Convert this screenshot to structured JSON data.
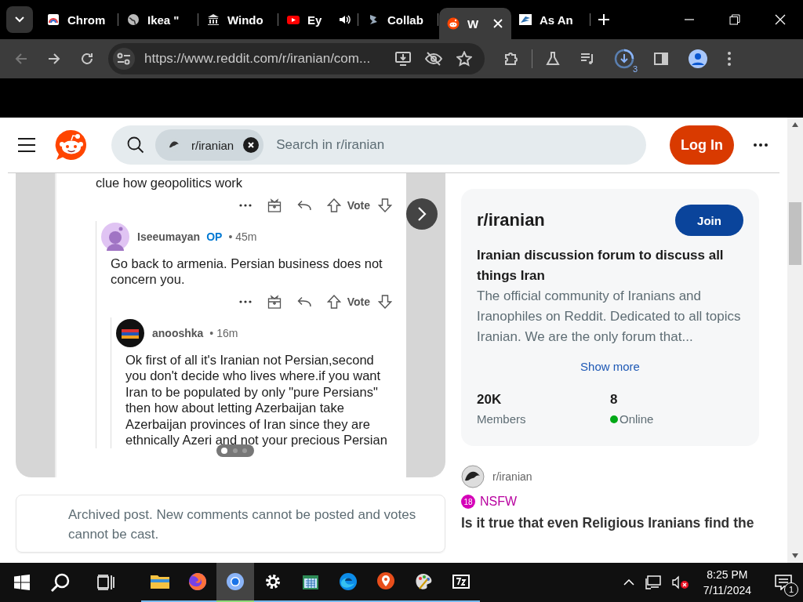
{
  "browser": {
    "tabs": [
      {
        "title": "Chrom",
        "selected": false,
        "audio": false
      },
      {
        "title": "Ikea \"",
        "selected": false,
        "audio": false
      },
      {
        "title": "Windo",
        "selected": false,
        "audio": false
      },
      {
        "title": "Ey",
        "selected": false,
        "audio": true
      },
      {
        "title": "Collab",
        "selected": false,
        "audio": false
      },
      {
        "title": "W",
        "selected": true,
        "audio": false
      },
      {
        "title": "As An",
        "selected": false,
        "audio": false
      }
    ],
    "url": "https://www.reddit.com/r/iranian/com...",
    "download_badge": "3"
  },
  "reddit": {
    "header": {
      "search_chip": "r/iranian",
      "placeholder": "Search in r/iranian",
      "login": "Log In"
    },
    "media": {
      "comments": [
        {
          "kind": "fragment",
          "text": "clue how geopolitics work",
          "vote": "Vote"
        },
        {
          "kind": "comment",
          "author": "Iseeumayan",
          "op": "OP",
          "time": "• 45m",
          "text": "Go back to armenia. Persian business does not concern you.",
          "vote": "Vote"
        },
        {
          "kind": "comment",
          "author": "anooshka",
          "time": "• 16m",
          "text": "Ok first of all it's Iranian not Persian,second you don't decide who lives where.if you want Iran to be populated by only \"pure Persians\" then how about letting Azerbaijan take Azerbaijan provinces of Iran since they are ethnically Azeri and not your precious Persian"
        }
      ]
    },
    "archived": "Archived post. New comments cannot be posted and votes cannot be cast.",
    "community": {
      "name": "r/iranian",
      "join": "Join",
      "tagline": "Iranian discussion forum to discuss all things Iran",
      "description": "The official community of Iranians and Iranophiles on Reddit. Dedicated to all topics Iranian. We are the only forum that...",
      "show_more": "Show more",
      "stats": [
        {
          "kind": "count",
          "value": "20K",
          "label": "Members"
        },
        {
          "kind": "online",
          "value": "8",
          "label": "Online"
        }
      ]
    },
    "related": {
      "community": "r/iranian",
      "nsfw_badge": "18",
      "nsfw": "NSFW",
      "title": "Is it true that even Religious Iranians find the"
    }
  },
  "taskbar": {
    "apps": [
      {
        "selected": false,
        "running": true
      },
      {
        "selected": false,
        "running": true
      },
      {
        "selected": true,
        "running": true
      },
      {
        "selected": false,
        "running": true
      },
      {
        "selected": false,
        "running": true
      },
      {
        "selected": false,
        "running": true
      },
      {
        "selected": false,
        "running": true
      },
      {
        "selected": false,
        "running": true
      },
      {
        "selected": false,
        "running": true
      }
    ],
    "time": "8:25 PM",
    "date": "7/11/2024",
    "notifications": "1"
  }
}
